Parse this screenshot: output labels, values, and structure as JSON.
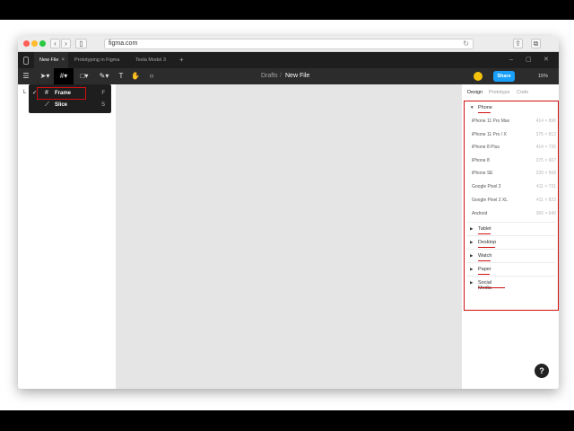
{
  "browser": {
    "url": "figma.com"
  },
  "tabs": [
    {
      "label": "New File",
      "active": true
    },
    {
      "label": "Prototyping in Figma",
      "active": false
    },
    {
      "label": "Tesla Model 3",
      "active": false
    }
  ],
  "tab_close": "×",
  "tab_new": "+",
  "breadcrumb": {
    "folder": "Drafts",
    "separator": "/",
    "file": "New File"
  },
  "toolbar": {
    "share_label": "Share",
    "zoom": "15%"
  },
  "dropdown": {
    "items": [
      {
        "label": "Frame",
        "shortcut": "F",
        "checked": true
      },
      {
        "label": "Slice",
        "shortcut": "S",
        "checked": false
      }
    ]
  },
  "left_panel": {
    "hint": "L"
  },
  "right_panel": {
    "tabs": [
      "Design",
      "Prototype",
      "Code"
    ],
    "phone_section": "Phone",
    "devices": [
      {
        "name": "iPhone 11 Pro Max",
        "size": "414 × 896"
      },
      {
        "name": "iPhone 11 Pro / X",
        "size": "375 × 812"
      },
      {
        "name": "iPhone 8 Plus",
        "size": "414 × 736"
      },
      {
        "name": "iPhone 8",
        "size": "375 × 667"
      },
      {
        "name": "iPhone SE",
        "size": "320 × 568"
      },
      {
        "name": "Google Pixel 2",
        "size": "411 × 731"
      },
      {
        "name": "Google Pixel 2 XL",
        "size": "411 × 823"
      },
      {
        "name": "Android",
        "size": "360 × 640"
      }
    ],
    "sections": [
      "Tablet",
      "Desktop",
      "Watch",
      "Paper",
      "Social Media"
    ]
  },
  "help_label": "?",
  "colors": {
    "accent": "#18a0fb",
    "annotation": "#d01010",
    "avatar": "#f4c20d"
  }
}
